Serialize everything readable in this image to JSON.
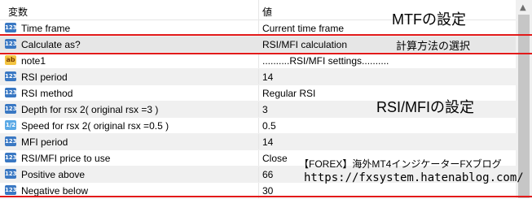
{
  "header": {
    "col_name": "変数",
    "col_value": "値"
  },
  "rows": [
    {
      "icon": "123",
      "name": "Time frame",
      "value": "Current time frame"
    },
    {
      "icon": "123",
      "name": "Calculate as?",
      "value": "RSI/MFI calculation"
    },
    {
      "icon": "ab",
      "name": "note1",
      "value": "..........RSI/MFI settings.........."
    },
    {
      "icon": "123",
      "name": "RSI period",
      "value": "14"
    },
    {
      "icon": "123",
      "name": "RSI method",
      "value": "Regular RSI"
    },
    {
      "icon": "123",
      "name": "Depth for rsx 2( original rsx =3 )",
      "value": "3"
    },
    {
      "icon": "1/2",
      "name": "Speed for rsx 2( original rsx =0.5 )",
      "value": "0.5"
    },
    {
      "icon": "123",
      "name": "MFI period",
      "value": "14"
    },
    {
      "icon": "123",
      "name": "RSI/MFI price to use",
      "value": "Close"
    },
    {
      "icon": "123",
      "name": "Positive above",
      "value": "66"
    },
    {
      "icon": "123",
      "name": "Negative below",
      "value": "30"
    }
  ],
  "annotations": {
    "mtf": "MTFの設定",
    "calc": "計算方法の選択",
    "rsimfi": "RSI/MFIの設定",
    "watermark1": "【FOREX】海外MT4インジケーターFXブログ",
    "watermark2": "https://fxsystem.hatenablog.com/"
  },
  "scrollbar": {
    "arrow": "▲"
  },
  "colors": {
    "highlight_line": "#e21a1a",
    "icon_int": "#3a78c3",
    "icon_string": "#f4c542",
    "icon_double": "#5aa9e6"
  }
}
